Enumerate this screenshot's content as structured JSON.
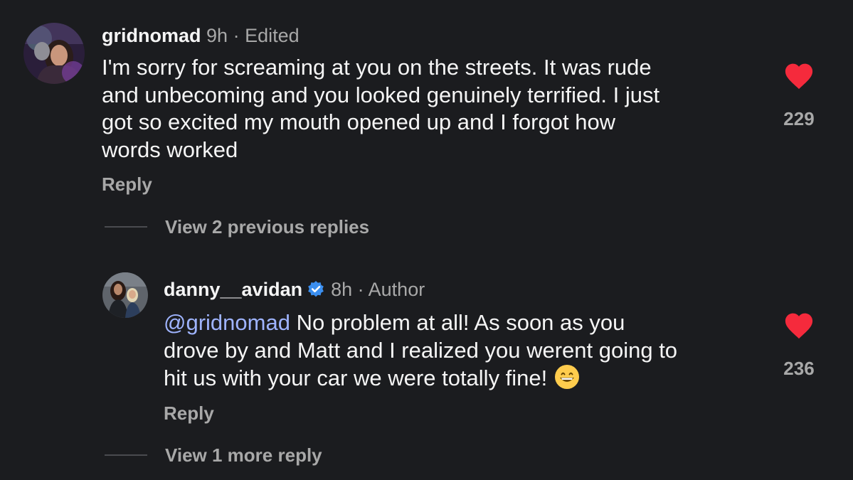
{
  "colors": {
    "background": "#1b1c1f",
    "text": "#f5f5f5",
    "muted": "#a8a8a8",
    "mention": "#9fb4ff",
    "heart": "#f52a3c",
    "verified": "#3b8ff0"
  },
  "comment": {
    "username": "gridnomad",
    "time": "9h",
    "separator": "·",
    "edited": "Edited",
    "lines": [
      "I'm sorry for screaming at you on the streets. It was rude",
      "and unbecoming and you looked genuinely terrified. I just",
      "got so excited my mouth opened up and I forgot how",
      "words worked"
    ],
    "reply_label": "Reply",
    "likes": "229",
    "like_icon": "heart-icon",
    "view_replies_label": "View 2 previous replies"
  },
  "reply": {
    "username": "danny__avidan",
    "verified_icon": "verified-badge-icon",
    "time": "8h",
    "separator": "·",
    "author_label": "Author",
    "mention": "@gridnomad",
    "line1_rest": " No problem at all!  As soon as you",
    "line2": "drove by and Matt and I realized you werent going to",
    "line3": "hit us with your car we were totally fine!",
    "emoji": "grinning-face-emoji",
    "reply_label": "Reply",
    "likes": "236",
    "like_icon": "heart-icon",
    "view_more_label": "View 1 more reply"
  }
}
